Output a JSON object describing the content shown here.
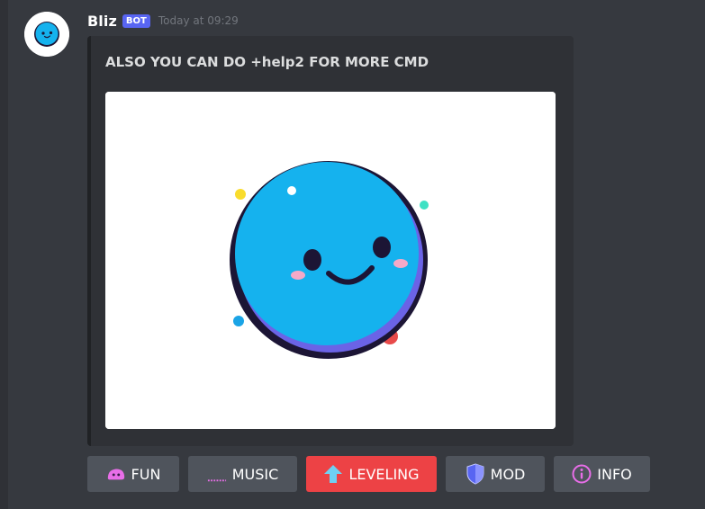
{
  "message": {
    "username": "Bliz",
    "bot_tag": "BOT",
    "timestamp": "Today at 09:29"
  },
  "embed": {
    "title": "ALSO YOU CAN DO +help2 FOR MORE CMD",
    "image_icon": "smiling-blue-face-icon"
  },
  "buttons": [
    {
      "label": "FUN",
      "icon": "slime-icon",
      "style": "secondary"
    },
    {
      "label": "MUSIC",
      "icon": "music-bar-icon",
      "style": "secondary"
    },
    {
      "label": "LEVELING",
      "icon": "up-arrow-icon",
      "style": "danger"
    },
    {
      "label": "MOD",
      "icon": "shield-icon",
      "style": "secondary"
    },
    {
      "label": "INFO",
      "icon": "info-icon",
      "style": "secondary"
    }
  ],
  "colors": {
    "background": "#36393f",
    "embed_background": "#2f3136",
    "bot_tag": "#5865f2",
    "secondary_button": "#4f545c",
    "danger_button": "#ed4245",
    "face_blue": "#15b2ee",
    "face_outline": "#1c1535"
  }
}
